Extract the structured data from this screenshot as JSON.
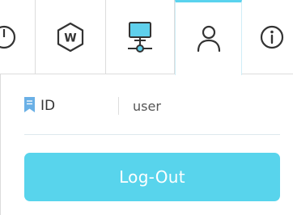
{
  "tabs": [
    {
      "icon": "power-icon",
      "active": false
    },
    {
      "icon": "w-hexagon-icon",
      "label": "W",
      "active": false
    },
    {
      "icon": "network-monitor-icon",
      "active": false
    },
    {
      "icon": "user-icon",
      "active": true
    },
    {
      "icon": "info-icon",
      "active": false
    }
  ],
  "account": {
    "id_label": "ID",
    "id_value": "user",
    "logout_label": "Log-Out"
  },
  "colors": {
    "accent": "#58d4ec",
    "active_tab_border": "#5ad3ee",
    "bookmark": "#6ab0e6",
    "monitor_fill": "#5fd0ec",
    "icon_stroke": "#333333"
  }
}
